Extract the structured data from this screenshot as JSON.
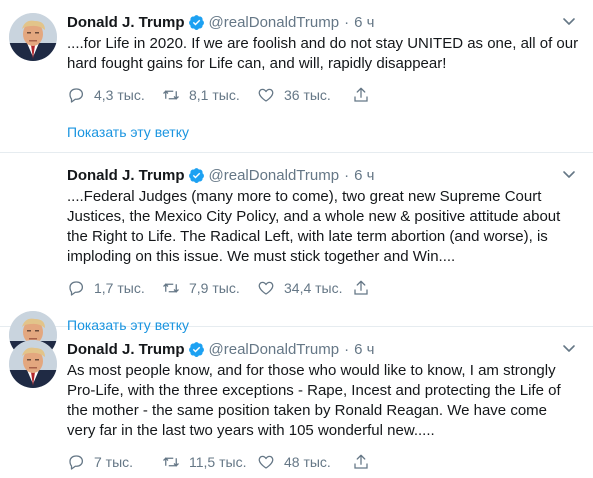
{
  "colors": {
    "link": "#1b95e0",
    "verified": "#1da1f2",
    "muted": "#657786",
    "text": "#14171a",
    "divider": "#e6ecf0"
  },
  "tweets": [
    {
      "name": "Donald J. Trump",
      "handle": "@realDonaldTrump",
      "separator": "·",
      "time": "6 ч",
      "text": "....for Life in 2020. If we are foolish and do not stay UNITED as one, all of our hard fought gains for Life can, and will, rapidly disappear!",
      "replies": "4,3 тыс.",
      "retweets": "8,1 тыс.",
      "likes": "36 тыс.",
      "thread_link": "Показать эту ветку"
    },
    {
      "name": "Donald J. Trump",
      "handle": "@realDonaldTrump",
      "separator": "·",
      "time": "6 ч",
      "text": "....Federal Judges (many more to come), two great new Supreme Court Justices, the Mexico City Policy, and a whole new & positive attitude about the Right to Life. The Radical Left, with late term abortion (and worse), is imploding on this issue. We must stick together and Win....",
      "replies": "1,7 тыс.",
      "retweets": "7,9 тыс.",
      "likes": "34,4 тыс.",
      "thread_link": "Показать эту ветку"
    },
    {
      "name": "Donald J. Trump",
      "handle": "@realDonaldTrump",
      "separator": "·",
      "time": "6 ч",
      "text": "As most people know, and for those who would like to know, I am strongly Pro-Life, with the three exceptions - Rape, Incest and protecting the Life of the mother - the same position taken by Ronald Reagan. We have come very far in the last two years with 105 wonderful new.....",
      "replies": "7 тыс.",
      "retweets": "11,5 тыс.",
      "likes": "48 тыс."
    }
  ]
}
